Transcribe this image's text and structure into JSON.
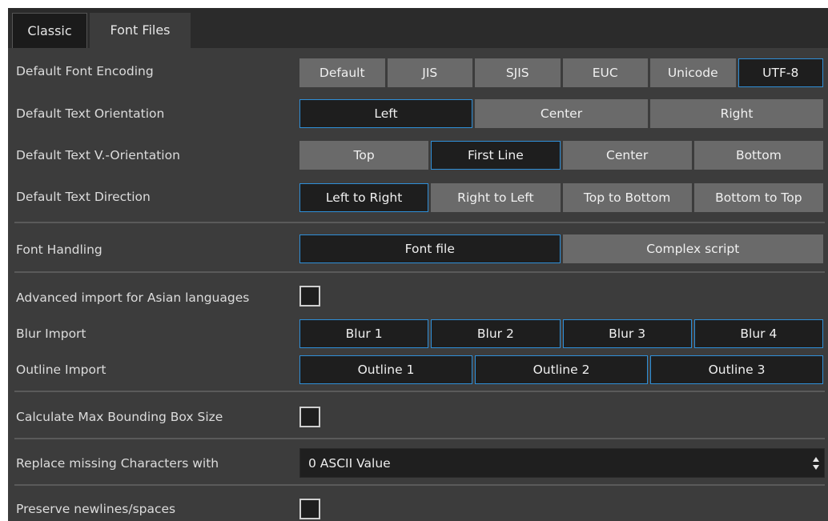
{
  "tabs": [
    {
      "label": "Classic",
      "active": true
    },
    {
      "label": "Font Files",
      "active": false
    }
  ],
  "encoding": {
    "label": "Default Font Encoding",
    "options": [
      "Default",
      "JIS",
      "SJIS",
      "EUC",
      "Unicode",
      "UTF-8"
    ],
    "selected": "UTF-8"
  },
  "orientation": {
    "label": "Default Text Orientation",
    "options": [
      "Left",
      "Center",
      "Right"
    ],
    "selected": "Left"
  },
  "v_orientation": {
    "label": "Default Text V.-Orientation",
    "options": [
      "Top",
      "First Line",
      "Center",
      "Bottom"
    ],
    "selected": "First Line"
  },
  "direction": {
    "label": "Default Text Direction",
    "options": [
      "Left to Right",
      "Right to Left",
      "Top to Bottom",
      "Bottom to Top"
    ],
    "selected": "Left to Right"
  },
  "font_handling": {
    "label": "Font Handling",
    "options": [
      "Font file",
      "Complex script"
    ],
    "selected": "Font file"
  },
  "asian_import": {
    "label": "Advanced import for Asian languages",
    "checked": false
  },
  "blur_import": {
    "label": "Blur Import",
    "options": [
      "Blur 1",
      "Blur 2",
      "Blur 3",
      "Blur 4"
    ],
    "selected": [
      "Blur 1",
      "Blur 2",
      "Blur 3",
      "Blur 4"
    ]
  },
  "outline_import": {
    "label": "Outline Import",
    "options": [
      "Outline 1",
      "Outline 2",
      "Outline 3"
    ],
    "selected": [
      "Outline 1",
      "Outline 2",
      "Outline 3"
    ]
  },
  "max_bbox": {
    "label": "Calculate Max Bounding Box Size",
    "checked": false
  },
  "replace_missing": {
    "label": "Replace missing Characters with",
    "value": "0 ASCII Value"
  },
  "preserve_newlines": {
    "label": "Preserve newlines/spaces",
    "checked": false
  },
  "colors": {
    "panel_bg": "#3c3c3c",
    "button_bg": "#6a6a6a",
    "selected_bg": "#1e1e1e",
    "selected_border": "#2f8fd8"
  }
}
